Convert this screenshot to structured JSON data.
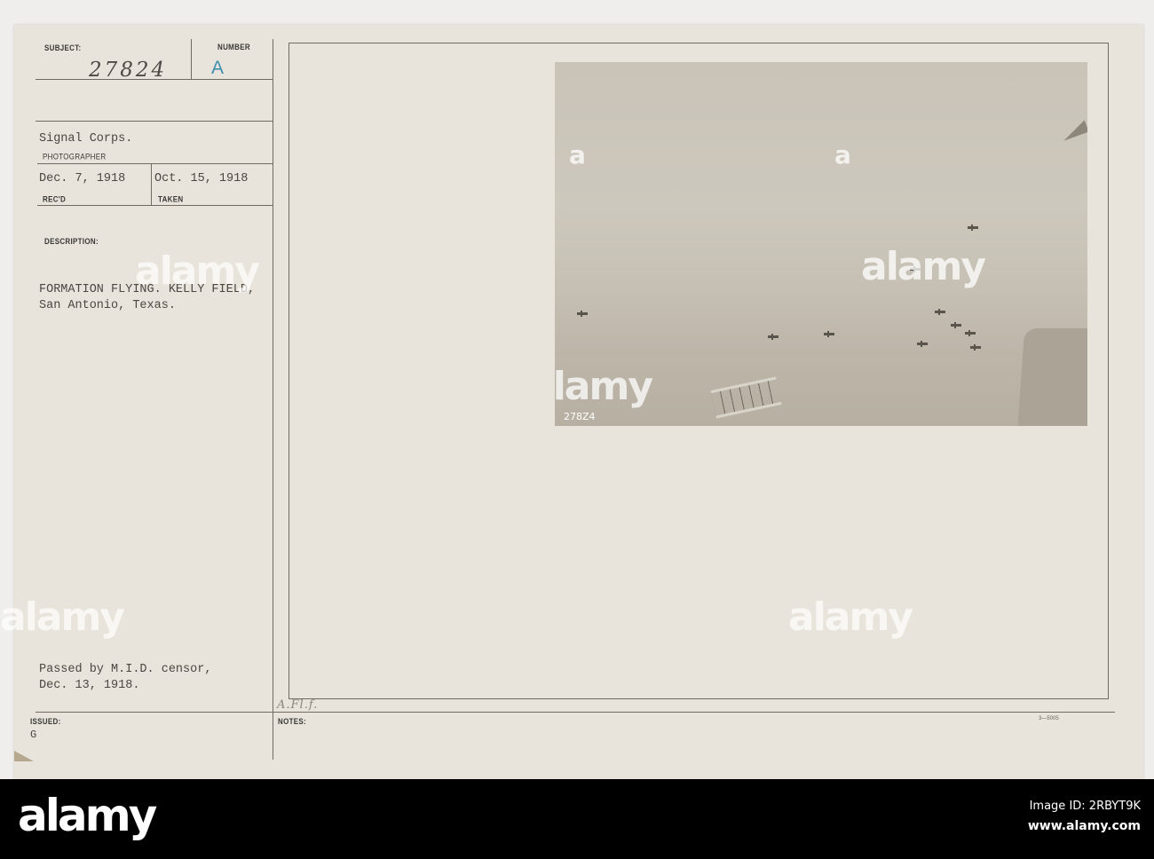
{
  "card": {
    "labels": {
      "subject": "SUBJECT:",
      "number": "NUMBER",
      "photographer": "PHOTOGRAPHER",
      "recd": "REC'D",
      "taken": "TAKEN",
      "description": "DESCRIPTION:",
      "issued": "ISSUED:",
      "notes": "NOTES:"
    },
    "subject_number": "27824",
    "number_value": "A",
    "photographer": "Signal Corps.",
    "recd_date": "Dec. 7, 1918",
    "taken_date": "Oct. 15, 1918",
    "description_line1": "FORMATION FLYING. KELLY FIELD,",
    "description_line2": "San Antonio, Texas.",
    "censor_line1": "Passed by M.I.D. censor,",
    "censor_line2": "Dec. 13, 1918.",
    "issued_value": "G",
    "notes_pencil": "A.Fl.f.",
    "form_number": "3—5005",
    "photo_caption": "278Z4"
  },
  "accent_colors": {
    "number_ink": "#3f8fb0",
    "card": "#e9e4db"
  },
  "watermark": {
    "text": "alamy",
    "letter": "a"
  },
  "footer": {
    "logo": "alamy",
    "image_id": "Image ID: 2RBYT9K",
    "site": "www.alamy.com"
  }
}
